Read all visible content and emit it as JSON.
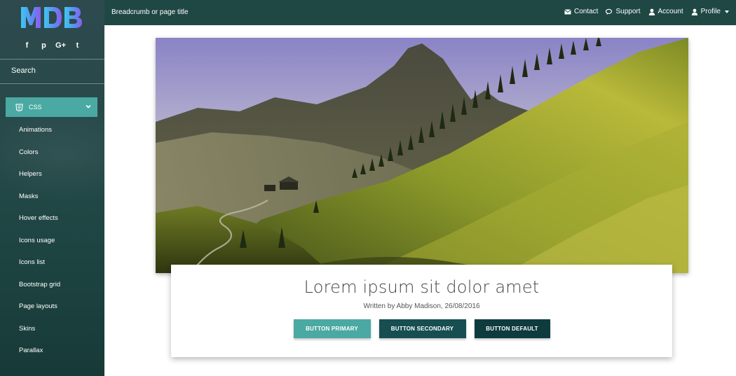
{
  "sidebar": {
    "logo_text": "MDB",
    "social_icons": [
      "facebook-icon",
      "pinterest-icon",
      "google-plus-icon",
      "twitter-icon"
    ],
    "social_glyphs": [
      "f",
      "p",
      "G+",
      "t"
    ],
    "search_label": "Search",
    "active_item": {
      "label": "CSS",
      "icon": "css3-icon"
    },
    "items": [
      {
        "label": "Animations"
      },
      {
        "label": "Colors"
      },
      {
        "label": "Helpers"
      },
      {
        "label": "Masks"
      },
      {
        "label": "Hover effects"
      },
      {
        "label": "Icons usage"
      },
      {
        "label": "Icons list"
      },
      {
        "label": "Bootstrap grid"
      },
      {
        "label": "Page layouts"
      },
      {
        "label": "Skins"
      },
      {
        "label": "Parallax"
      }
    ]
  },
  "topbar": {
    "breadcrumb": "Breadcrumb or page title",
    "links": [
      {
        "label": "Contact",
        "icon": "envelope-icon"
      },
      {
        "label": "Support",
        "icon": "comments-icon"
      },
      {
        "label": "Account",
        "icon": "user-icon"
      },
      {
        "label": "Profile",
        "icon": "user-icon"
      }
    ]
  },
  "card": {
    "title": "Lorem ipsum sit dolor amet",
    "subtitle": "Written by Abby Madison, 26/08/2016",
    "buttons": {
      "primary": "BUTTON PRIMARY",
      "secondary": "BUTTON SECONDARY",
      "default": "BUTTON DEFAULT"
    }
  },
  "colors": {
    "accent": "#4aa9a2",
    "topbar": "#1f4845",
    "secondary": "#164e52",
    "default": "#0d3b3e"
  }
}
